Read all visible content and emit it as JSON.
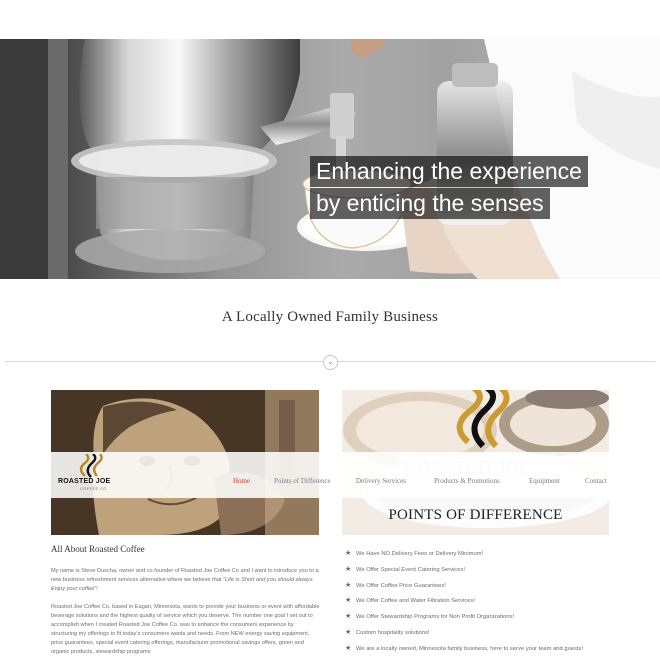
{
  "hero": {
    "line1": "Enhancing the experience",
    "line2": "by enticing the senses"
  },
  "section": {
    "title": "A Locally Owned Family Business",
    "divider_icon": "chevron-down-icon"
  },
  "logo": {
    "name": "ROASTED JOE",
    "sub": "COFFEE CO"
  },
  "nav": {
    "home": "Home",
    "points": "Points of Difference",
    "delivery": "Delivery Services",
    "products": "Products & Promotions",
    "equipment": "Equipment",
    "contact": "Contact"
  },
  "card": {
    "right_title": "POINTS OF DIFFERENCE"
  },
  "about": {
    "title": "All About Roasted Coffee",
    "p1_part1": "My name is Steve Duscha, owner and co founder of Roasted Joe Coffee Co and I want to introduce you to a new business refreshment services alternative where we believe that \"",
    "p1_quote": "Life is Short and you should always Enjoy your coffee",
    "p1_part2": "\"!",
    "p2": "Roasted Joe Coffee Co. based in Eagan, Minnesota, wants to provide your business or event with affordable beverage solutions and the highest quality of service which you deserve. The number one goal I set out to accomplish when I created Roasted Joe Coffee Co. was to enhance the consumers experience by structuring my offerings to fit today's consumers wants and needs. From NEW energy saving equipment, price guarantees, special event catering offerings, manufacturer promotional savings offers, green and organic products, stewardship programs"
  },
  "differences": [
    "We Have NO Delivery Fees or Delivery Minimum!",
    "We Offer Special Event Catering Services!",
    "We Offer Coffee Price Guarantees!",
    "We Offer Coffee and Water Filtration Services!",
    "We Offer Stewardship Programs for Non Profit Organizations!",
    "Custom hospitality solutions!",
    "We are a locally owned, Minnesota family business, here to serve your team and guests!"
  ],
  "list_icon": "star-icon",
  "colors": {
    "accent": "#c13a2f",
    "brand_gold": "#8b6f2f",
    "text": "#6e6e6e"
  }
}
